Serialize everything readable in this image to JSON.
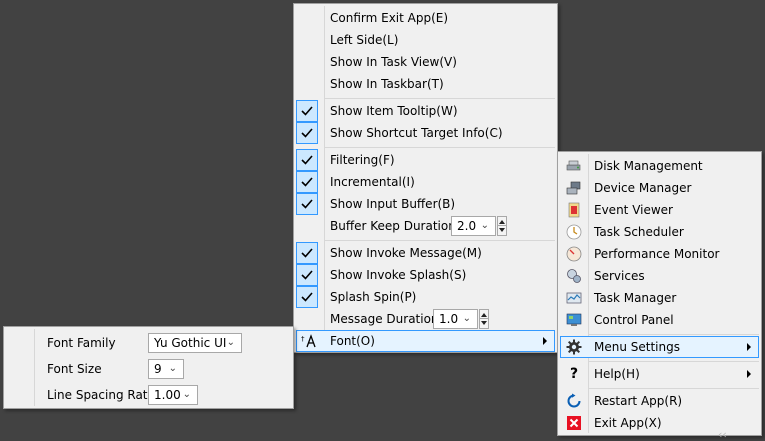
{
  "main_menu": {
    "items": [
      {
        "label": "Confirm Exit App(E)",
        "checked": false
      },
      {
        "label": "Left Side(L)",
        "checked": false
      },
      {
        "label": "Show In Task View(V)",
        "checked": false
      },
      {
        "label": "Show In Taskbar(T)",
        "checked": false
      },
      {
        "label": "Show Item Tooltip(W)",
        "checked": true
      },
      {
        "label": "Show Shortcut Target Info(C)",
        "checked": true
      },
      {
        "label": "Filtering(F)",
        "checked": true
      },
      {
        "label": "Incremental(I)",
        "checked": true
      },
      {
        "label": "Show Input Buffer(B)",
        "checked": true
      },
      {
        "label": "Buffer Keep Duration:",
        "value": "2.0"
      },
      {
        "label": "Show Invoke Message(M)",
        "checked": true
      },
      {
        "label": "Show Invoke Splash(S)",
        "checked": true
      },
      {
        "label": "Splash Spin(P)",
        "checked": true
      },
      {
        "label": "Message Duration:",
        "value": "1.0"
      },
      {
        "label": "Font(O)"
      }
    ]
  },
  "font_panel": {
    "family_label": "Font Family",
    "family_value": "Yu Gothic UI",
    "size_label": "Font Size",
    "size_value": "9",
    "spacing_label": "Line Spacing Ratio",
    "spacing_value": "1.00"
  },
  "tools_menu": {
    "items": [
      {
        "label": "Disk Management",
        "icon": "disk-management-icon"
      },
      {
        "label": "Device Manager",
        "icon": "device-manager-icon"
      },
      {
        "label": "Event Viewer",
        "icon": "event-viewer-icon"
      },
      {
        "label": "Task Scheduler",
        "icon": "task-scheduler-icon"
      },
      {
        "label": "Performance Monitor",
        "icon": "performance-monitor-icon"
      },
      {
        "label": "Services",
        "icon": "services-icon"
      },
      {
        "label": "Task Manager",
        "icon": "task-manager-icon"
      },
      {
        "label": "Control Panel",
        "icon": "control-panel-icon"
      },
      {
        "label": "Menu Settings",
        "icon": "gear-icon"
      },
      {
        "label": "Help(H)",
        "icon": "question-icon"
      },
      {
        "label": "Restart App(R)",
        "icon": "restart-icon"
      },
      {
        "label": "Exit App(X)",
        "icon": "exit-icon"
      }
    ]
  },
  "colors": {
    "accent": "#3399ff",
    "check_bg": "#cce8ff",
    "desktop": "#424242",
    "exit_red": "#e81123",
    "restart_blue": "#0a5fb4"
  }
}
